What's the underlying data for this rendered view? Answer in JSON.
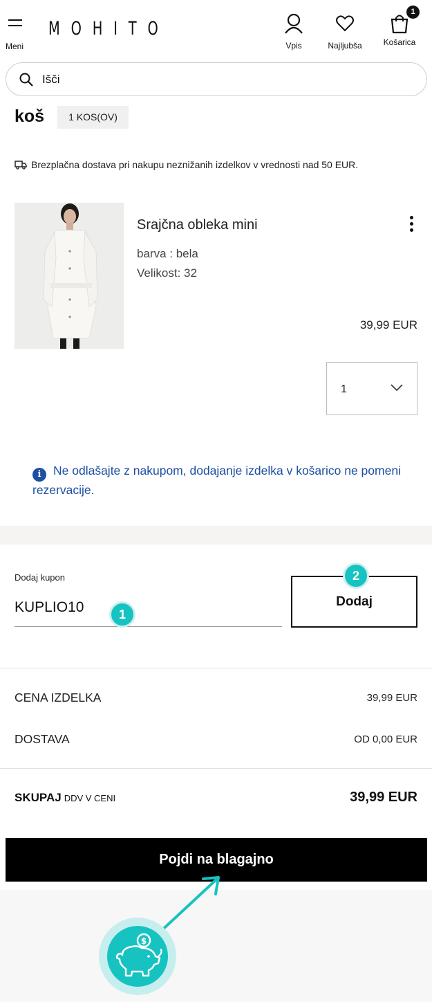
{
  "header": {
    "menu_label": "Meni",
    "logo": "MOHITO",
    "login_label": "Vpis",
    "wishlist_label": "Najljubša",
    "cart_label": "Košarica",
    "cart_count": "1"
  },
  "search": {
    "placeholder": "Išči"
  },
  "cart": {
    "title": "koš",
    "count_label": "1 KOS(OV)",
    "shipping_notice": "Brezplačna dostava pri nakupu neznižanih izdelkov v vrednosti nad 50 EUR."
  },
  "product": {
    "name": "Srajčna obleka mini",
    "color_line": "barva : bela",
    "size_line": "Velikost: 32",
    "price": "39,99 EUR",
    "quantity": "1",
    "image_icon": "white-shirt-dress-photo"
  },
  "notice": {
    "text": "Ne odlašajte z nakupom, dodajanje izdelka v košarico ne pomeni rezervacije."
  },
  "coupon": {
    "label": "Dodaj kupon",
    "value": "KUPLIO10",
    "add_label": "Dodaj",
    "step1": "1",
    "step2": "2"
  },
  "summary": {
    "items_label": "CENA IZDELKA",
    "items_value": "39,99 EUR",
    "delivery_label": "DOSTAVA",
    "delivery_value": "OD 0,00 EUR",
    "total_label": "SKUPAJ",
    "total_note": "DDV V CENI",
    "total_value": "39,99 EUR"
  },
  "checkout": {
    "label": "Pojdi na blagajno"
  },
  "colors": {
    "accent_teal": "#17c3c0",
    "notice_blue": "#1d4fa3",
    "primary_black": "#000000"
  }
}
